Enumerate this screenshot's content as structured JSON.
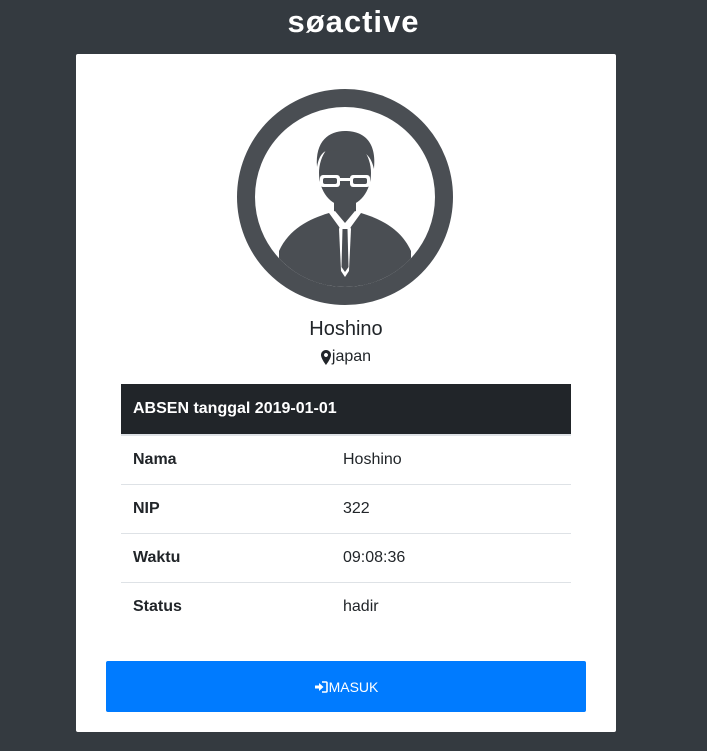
{
  "brand": {
    "logo_text": "søactive"
  },
  "profile": {
    "name": "Hoshino",
    "location": "japan",
    "avatar_icon": "user-avatar-icon"
  },
  "attendance": {
    "header": "ABSEN tanggal 2019-01-01",
    "rows": [
      {
        "label": "Nama",
        "value": "Hoshino"
      },
      {
        "label": "NIP",
        "value": "322"
      },
      {
        "label": "Waktu",
        "value": "09:08:36"
      },
      {
        "label": "Status",
        "value": "hadir"
      }
    ]
  },
  "action": {
    "button_label": "MASUK",
    "button_icon": "sign-in-icon",
    "color": "#007bff"
  },
  "colors": {
    "background": "#343a40",
    "table_header": "#212529",
    "accent": "#007bff"
  }
}
